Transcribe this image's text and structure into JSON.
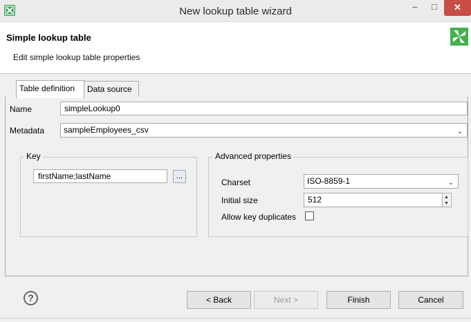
{
  "window": {
    "title": "New lookup table wizard",
    "minimize_glyph": "–",
    "maximize_glyph": "□",
    "close_glyph": "✕"
  },
  "header": {
    "title": "Simple lookup table",
    "subtitle": "Edit simple lookup table properties"
  },
  "tabs": [
    {
      "label": "Table definition",
      "active": true
    },
    {
      "label": "Data source",
      "active": false
    }
  ],
  "form": {
    "name_label": "Name",
    "name_value": "simpleLookup0",
    "metadata_label": "Metadata",
    "metadata_value": "sampleEmployees_csv"
  },
  "key_group": {
    "title": "Key",
    "value": "firstName;lastName",
    "browse_label": "..."
  },
  "advanced": {
    "title": "Advanced properties",
    "charset_label": "Charset",
    "charset_value": "ISO-8859-1",
    "initial_size_label": "Initial size",
    "initial_size_value": "512",
    "allow_dup_label": "Allow key duplicates",
    "allow_dup_checked": false
  },
  "footer": {
    "help_glyph": "?",
    "back_label": "< Back",
    "next_label": "Next >",
    "finish_label": "Finish",
    "cancel_label": "Cancel"
  },
  "colors": {
    "close_button": "#c94d47",
    "logo_green": "#44b14d"
  }
}
